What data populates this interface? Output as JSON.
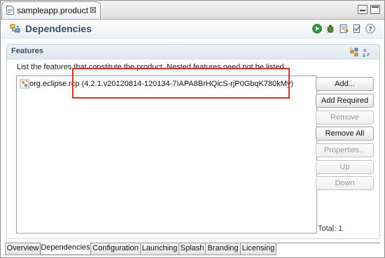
{
  "window": {
    "tab_title": "sampleapp.product",
    "tab_close": "⊠"
  },
  "header": {
    "title": "Dependencies",
    "icons": [
      "run-icon",
      "debug-icon",
      "export-wizard-icon",
      "validate-icon",
      "help-icon"
    ]
  },
  "features": {
    "section_title": "Features",
    "description": "List the features that constitute the product.  Nested features need not be listed.",
    "items": [
      {
        "label": "org.eclipse.rcp (4.2.1.v20120814-120134-7IAPA8BrHQicS-rjP0GbqK780kMy)"
      }
    ],
    "buttons": {
      "add": "Add...",
      "add_required": "Add Required",
      "remove": "Remove",
      "remove_all": "Remove All",
      "properties": "Properties...",
      "up": "Up",
      "down": "Down"
    },
    "total": "Total: 1"
  },
  "page_tabs": [
    "Overview",
    "Dependencies",
    "Configuration",
    "Launching",
    "Splash",
    "Branding",
    "Licensing"
  ],
  "colors": {
    "highlight": "#e0301e",
    "title": "#3b4f6a"
  }
}
